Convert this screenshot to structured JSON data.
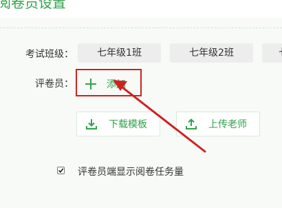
{
  "header": {
    "title": "阅卷员设置"
  },
  "exam_class": {
    "label": "考试班级：",
    "classes": [
      "七年级1班",
      "七年级2班",
      "七"
    ]
  },
  "graders": {
    "label": "评卷员：",
    "add_label": "添加"
  },
  "actions": {
    "download_template": "下载模板",
    "upload_teacher": "上传老师"
  },
  "option": {
    "show_task_label": "评卷员端显示阅卷任务量",
    "show_task_checked": true
  },
  "colors": {
    "accent": "#2ea24a",
    "annotation": "#d0201f"
  }
}
